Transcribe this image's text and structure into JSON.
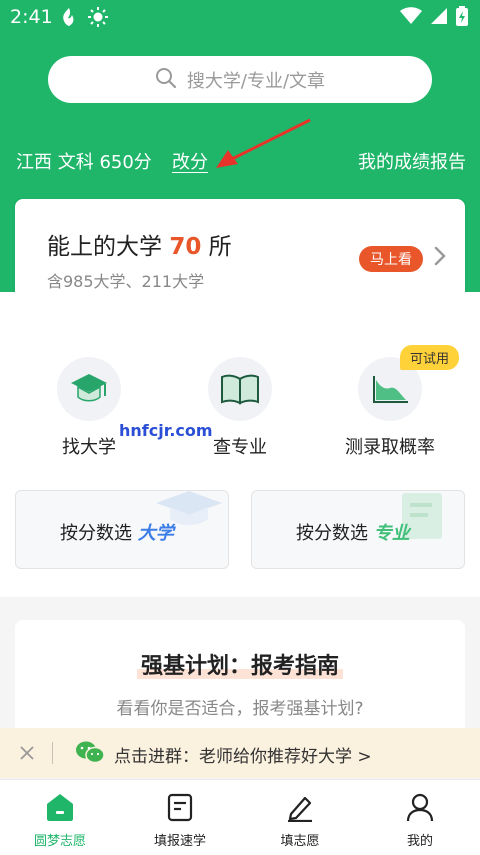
{
  "status_bar": {
    "time": "2:41"
  },
  "search": {
    "placeholder": "搜大学/专业/文章"
  },
  "score": {
    "info": "江西 文科 650分",
    "change_label": "改分",
    "report_label": "我的成绩报告"
  },
  "main_card": {
    "title_prefix": "能上的大学 ",
    "count": "70",
    "title_suffix": " 所",
    "subtitle": "含985大学、211大学",
    "go_button": "马上看"
  },
  "functions": [
    {
      "label": "找大学"
    },
    {
      "label": "查专业"
    },
    {
      "label": "测录取概率",
      "badge": "可试用"
    }
  ],
  "watermark": "hnfcjr.com",
  "select_cards": [
    {
      "label": "按分数选",
      "highlight": "大学"
    },
    {
      "label": "按分数选",
      "highlight": "专业"
    }
  ],
  "guide": {
    "title": "强基计划：报考指南",
    "subtitle": "看看你是否适合，报考强基计划?"
  },
  "banner": {
    "text": "点击进群：老师给你推荐好大学 >"
  },
  "tabbar": [
    {
      "label": "圆梦志愿",
      "active": true
    },
    {
      "label": "填报速学",
      "active": false
    },
    {
      "label": "填志愿",
      "active": false
    },
    {
      "label": "我的",
      "active": false
    }
  ],
  "colors": {
    "brand_green": "#1fb66a",
    "accent_orange": "#e8562a",
    "badge_yellow": "#ffd23a"
  }
}
